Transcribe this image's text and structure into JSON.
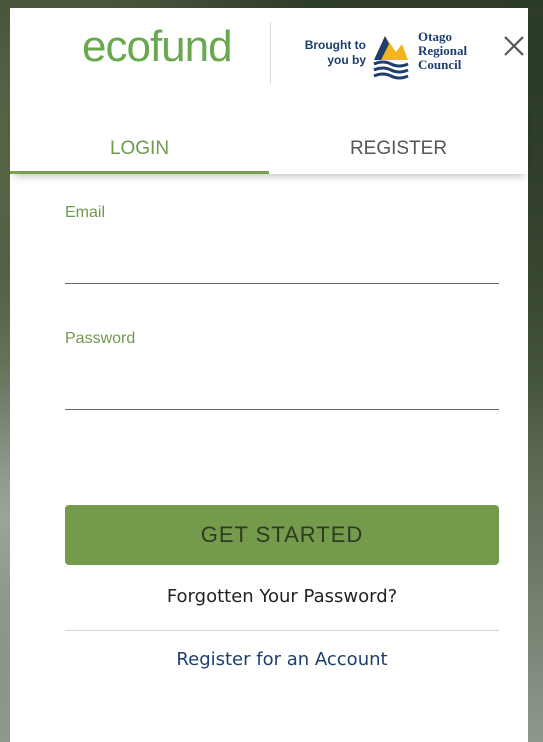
{
  "header": {
    "logo_text": "ecofund",
    "brought_by": "Brought to you by",
    "partner_line1": "Otago",
    "partner_line2": "Regional",
    "partner_line3": "Council"
  },
  "tabs": [
    {
      "label": "LOGIN",
      "active": true
    },
    {
      "label": "REGISTER",
      "active": false
    }
  ],
  "form": {
    "email_label": "Email",
    "email_value": "",
    "password_label": "Password",
    "password_value": ""
  },
  "actions": {
    "submit_label": "GET STARTED",
    "forgot_label": "Forgotten Your Password?",
    "register_label": "Register for an Account"
  },
  "colors": {
    "accent": "#6f9a4b",
    "button": "#749a4c",
    "partner_blue": "#1d3f6e"
  },
  "icons": [
    "close-icon",
    "orc-logo-icon"
  ]
}
